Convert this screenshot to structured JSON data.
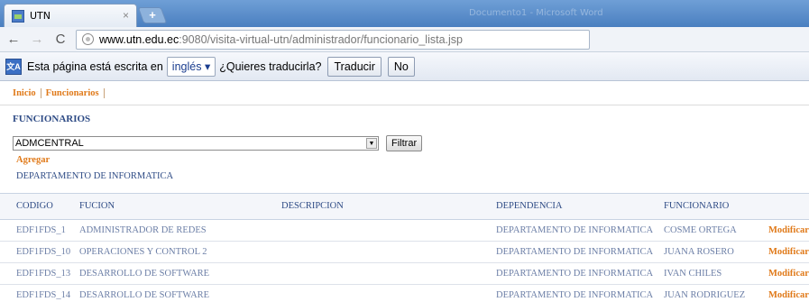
{
  "browser": {
    "tab_title": "UTN",
    "tab_close": "×",
    "new_tab": "+",
    "window_title": "Documento1 - Microsoft Word",
    "url_host": "www.utn.edu.ec",
    "url_rest": ":9080/visita-virtual-utn/administrador/funcionario_lista.jsp"
  },
  "translate_bar": {
    "prefix": "Esta página está escrita en",
    "language": "inglés",
    "question": "¿Quieres traducirla?",
    "translate_label": "Traducir",
    "no_label": "No"
  },
  "menu": {
    "items": [
      "Inicio",
      "Funcionarios"
    ]
  },
  "page": {
    "title": "FUNCIONARIOS",
    "select_value": "ADMCENTRAL",
    "filter_label": "Filtrar",
    "add_label": "Agregar",
    "department_title": "DEPARTAMENTO DE INFORMATICA"
  },
  "table": {
    "headers": [
      "CODIGO",
      "FUCION",
      "DESCRIPCION",
      "DEPENDENCIA",
      "FUNCIONARIO"
    ],
    "action_label": "Modificar",
    "rows": [
      {
        "codigo": "EDF1FDS_1",
        "funcion": "ADMINISTRADOR DE REDES",
        "descripcion": "",
        "dependencia": "DEPARTAMENTO DE INFORMATICA",
        "funcionario": "COSME ORTEGA"
      },
      {
        "codigo": "EDF1FDS_10",
        "funcion": "OPERACIONES Y CONTROL 2",
        "descripcion": "",
        "dependencia": "DEPARTAMENTO DE INFORMATICA",
        "funcionario": "JUANA ROSERO"
      },
      {
        "codigo": "EDF1FDS_13",
        "funcion": "DESARROLLO DE SOFTWARE",
        "descripcion": "",
        "dependencia": "DEPARTAMENTO DE INFORMATICA",
        "funcionario": "IVAN CHILES"
      },
      {
        "codigo": "EDF1FDS_14",
        "funcion": "DESARROLLO DE SOFTWARE",
        "descripcion": "",
        "dependencia": "DEPARTAMENTO DE INFORMATICA",
        "funcionario": "JUAN RODRIGUEZ"
      }
    ]
  }
}
